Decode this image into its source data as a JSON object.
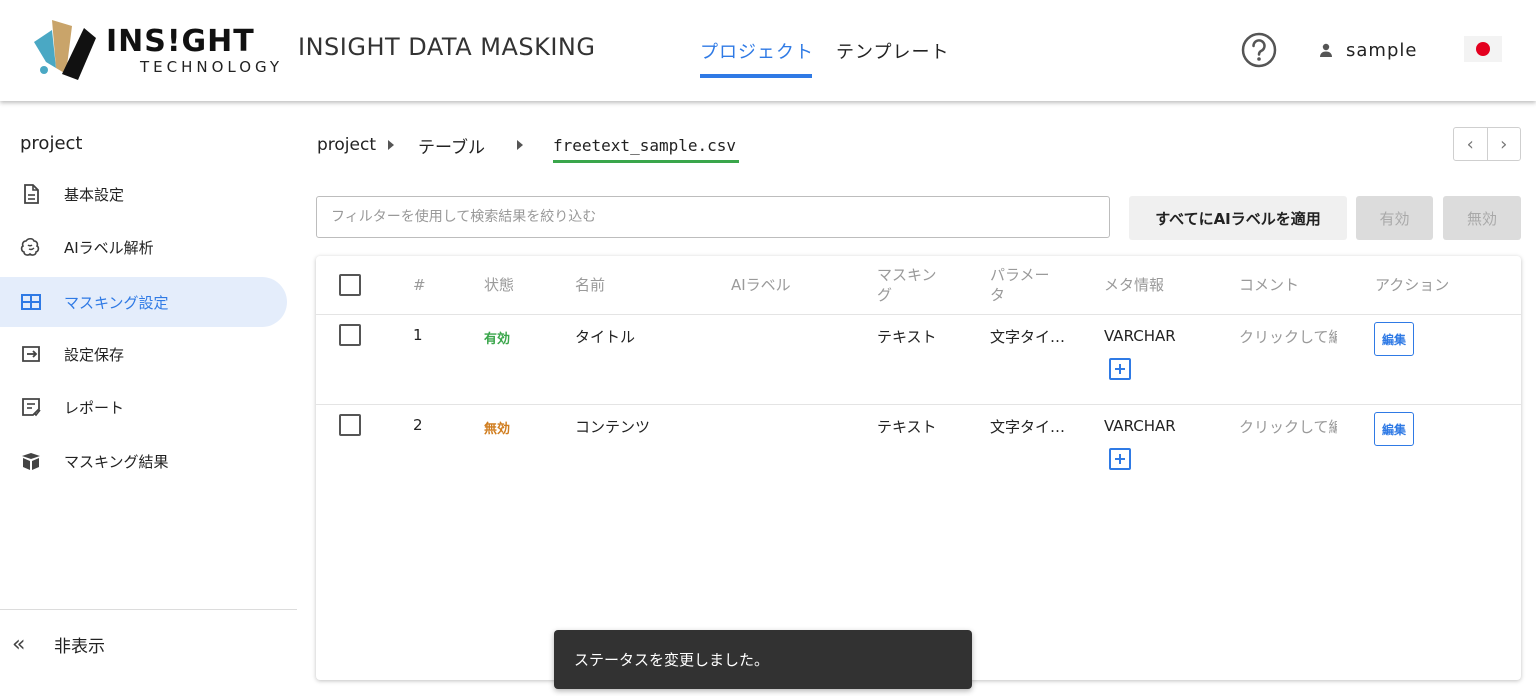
{
  "header": {
    "logo_text": "INS!GHT",
    "logo_subtext": "TECHNOLOGY",
    "app_title": "INSIGHT DATA MASKING",
    "nav": [
      {
        "label": "プロジェクト",
        "active": true
      },
      {
        "label": "テンプレート",
        "active": false
      }
    ],
    "help_icon": "question-circle-icon",
    "user": {
      "icon": "person-icon",
      "name": "sample"
    },
    "language_flag": "japan-flag-icon",
    "accent_color": "#2f7ae5"
  },
  "sidebar": {
    "project_title": "project",
    "items": [
      {
        "label": "基本設定",
        "icon": "document-icon",
        "active": false
      },
      {
        "label": "AIラベル解析",
        "icon": "brain-icon",
        "active": false
      },
      {
        "label": "マスキング設定",
        "icon": "table-grid-icon",
        "active": true
      },
      {
        "label": "設定保存",
        "icon": "save-export-icon",
        "active": false
      },
      {
        "label": "レポート",
        "icon": "report-icon",
        "active": false
      },
      {
        "label": "マスキング結果",
        "icon": "package-icon",
        "active": false
      }
    ],
    "hide_label": "非表示",
    "hide_icon": "double-chevron-left-icon"
  },
  "breadcrumb": {
    "items": [
      "project",
      "テーブル",
      "freetext_sample.csv"
    ]
  },
  "toolbar": {
    "filter_placeholder": "フィルターを使用して検索結果を絞り込む",
    "apply_ai_label": "すべてにAIラベルを適用",
    "enable_label": "有効",
    "disable_label": "無効"
  },
  "table": {
    "columns": {
      "number": "#",
      "status": "状態",
      "name": "名前",
      "ai_label": "AIラベル",
      "masking_line1": "マスキン",
      "masking_line2": "グ",
      "param_line1": "パラメー",
      "param_line2": "タ",
      "meta": "メタ情報",
      "comment": "コメント",
      "action": "アクション"
    },
    "rows": [
      {
        "number": "1",
        "status": "有効",
        "status_color": "#3aa64b",
        "name": "タイトル",
        "ai_label": "",
        "masking": "テキスト",
        "param": "文字タイ…",
        "meta": "VARCHAR",
        "comment": "クリックして編",
        "action": "編集"
      },
      {
        "number": "2",
        "status": "無効",
        "status_color": "#d07d1f",
        "name": "コンテンツ",
        "ai_label": "",
        "masking": "テキスト",
        "param": "文字タイ…",
        "meta": "VARCHAR",
        "comment": "クリックして編",
        "action": "編集"
      }
    ]
  },
  "toast": {
    "message": "ステータスを変更しました。"
  }
}
